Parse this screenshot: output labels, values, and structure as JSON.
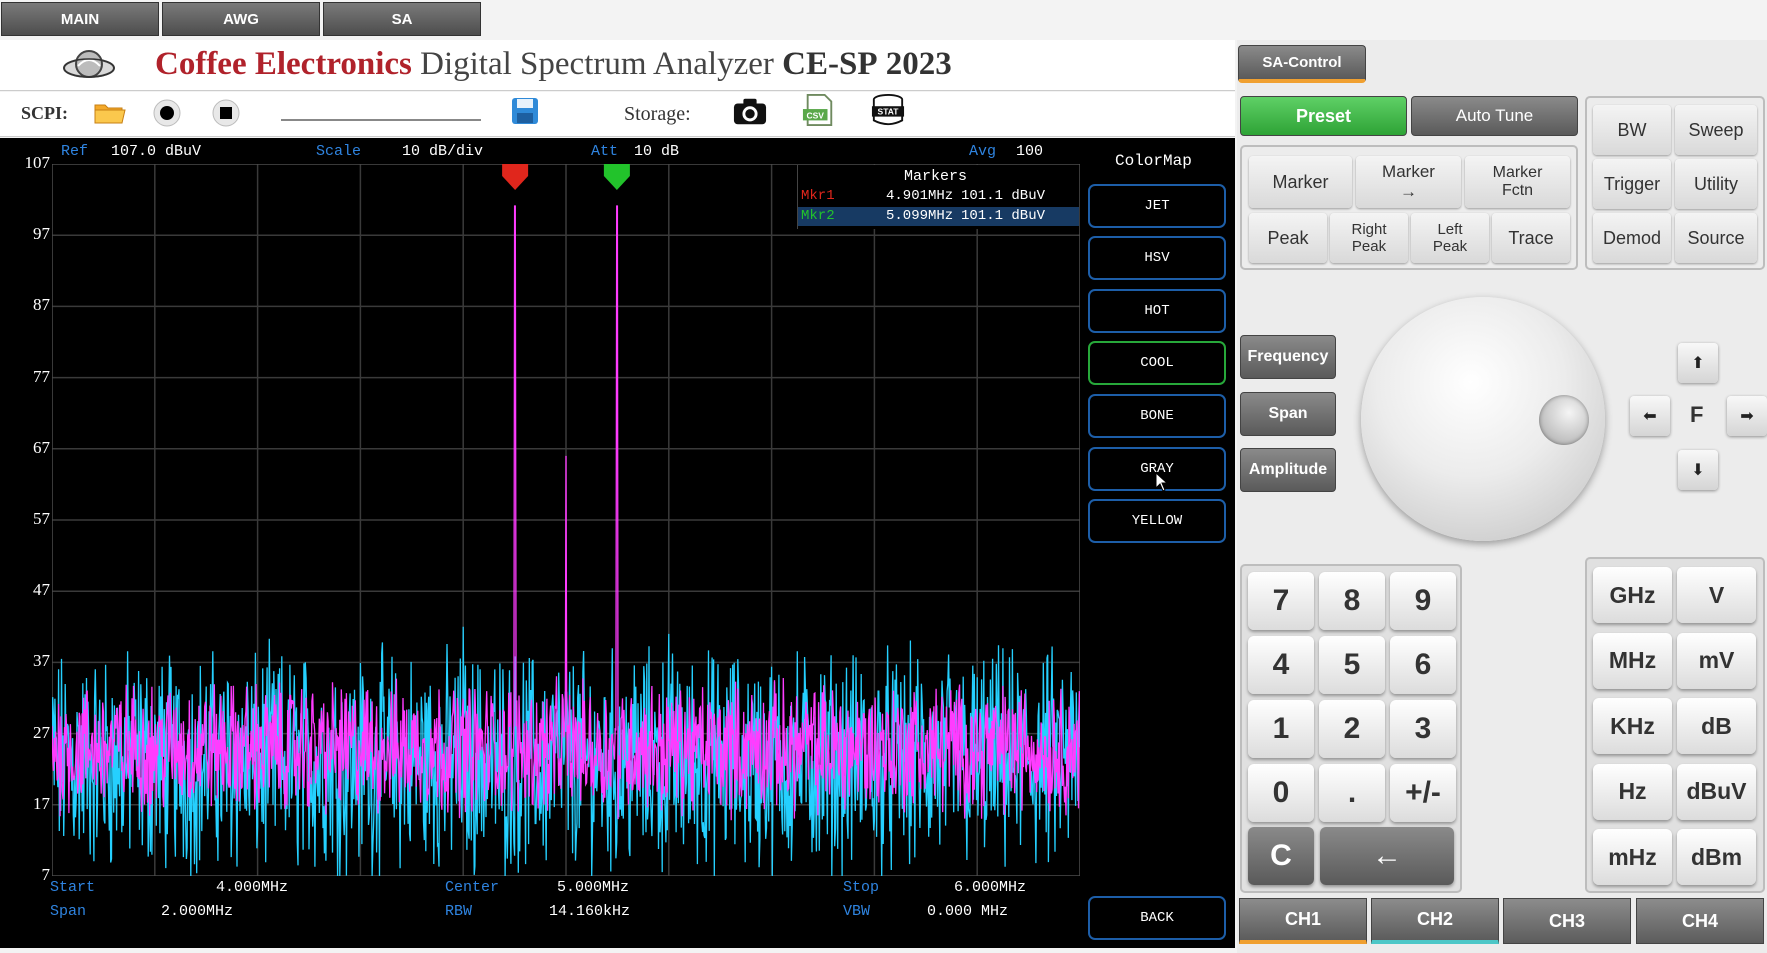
{
  "tabs": [
    "MAIN",
    "AWG",
    "SA"
  ],
  "header": {
    "brand": "Coffee Electronics",
    "subtitle": "Digital Spectrum Analyzer",
    "model": "CE-SP",
    "year": "2023"
  },
  "toolbar": {
    "scpi_label": "SCPI:",
    "storage_label": "Storage:",
    "icons": [
      "folder-icon",
      "record-icon",
      "stop-icon",
      "save-icon",
      "camera-icon",
      "csv-icon",
      "stat-icon"
    ],
    "csv_text": "CSV",
    "stat_text": "STAT"
  },
  "plot_header": {
    "ref_label": "Ref",
    "ref_value": "107.0 dBuV",
    "scale_label": "Scale",
    "scale_value": "10 dB/div",
    "att_label": "Att",
    "att_value": "10 dB",
    "avg_label": "Avg",
    "avg_value": "100"
  },
  "markers": {
    "title": "Markers",
    "rows": [
      {
        "name": "Mkr1",
        "freq": "4.901MHz",
        "level": "101.1 dBuV",
        "color": "#e0261c"
      },
      {
        "name": "Mkr2",
        "freq": "5.099MHz",
        "level": "101.1 dBuV",
        "color": "#22c32b"
      }
    ]
  },
  "plot_footer": {
    "start_label": "Start",
    "start_value": "4.000MHz",
    "center_label": "Center",
    "center_value": "5.000MHz",
    "stop_label": "Stop",
    "stop_value": "6.000MHz",
    "span_label": "Span",
    "span_value": "2.000MHz",
    "rbw_label": "RBW",
    "rbw_value": "14.160kHz",
    "vbw_label": "VBW",
    "vbw_value": "0.000 MHz"
  },
  "chart_data": {
    "type": "line",
    "xlabel": "",
    "ylabel": "",
    "xlim": [
      4.0,
      6.0
    ],
    "ylim": [
      7,
      107
    ],
    "y_ticks": [
      "107",
      "97",
      "87",
      "77",
      "67",
      "57",
      "47",
      "37",
      "27",
      "17",
      "7"
    ],
    "grid": true,
    "noise_floor": 25,
    "series": [
      {
        "color": "#ff3cff",
        "peaks": [
          {
            "x": 4.901,
            "y": 101.1
          },
          {
            "x": 5.099,
            "y": 101.1
          },
          {
            "x": 5.0,
            "y": 66
          }
        ]
      },
      {
        "color": "#25d0ff",
        "peaks": [
          {
            "x": 4.8,
            "y": 42
          },
          {
            "x": 5.2,
            "y": 41
          }
        ]
      }
    ],
    "markers": [
      {
        "x": 4.901,
        "y": 101.1,
        "color": "#e0261c"
      },
      {
        "x": 5.099,
        "y": 101.1,
        "color": "#22c32b"
      }
    ]
  },
  "colormap": {
    "title": "ColorMap",
    "options": [
      "JET",
      "HSV",
      "HOT",
      "COOL",
      "BONE",
      "GRAY",
      "YELLOW"
    ],
    "selected": "COOL",
    "back_label": "BACK"
  },
  "control": {
    "sa_control": "SA-Control",
    "preset": "Preset",
    "auto_tune": "Auto Tune",
    "marker": "Marker",
    "marker_arrow": "Marker\n→",
    "marker_fctn": "Marker\nFctn",
    "peak": "Peak",
    "right_peak": "Right\nPeak",
    "left_peak": "Left\nPeak",
    "trace": "Trace",
    "bw": "BW",
    "sweep": "Sweep",
    "trigger": "Trigger",
    "utility": "Utility",
    "demod": "Demod",
    "source": "Source",
    "frequency": "Frequency",
    "span": "Span",
    "amplitude": "Amplitude",
    "f_label": "F"
  },
  "keypad": {
    "keys": [
      "7",
      "8",
      "9",
      "4",
      "5",
      "6",
      "1",
      "2",
      "3",
      "0",
      ".",
      "+/-"
    ],
    "clear": "C",
    "backspace": "←"
  },
  "units": [
    "GHz",
    "V",
    "MHz",
    "mV",
    "KHz",
    "dB",
    "Hz",
    "dBuV",
    "mHz",
    "dBm"
  ],
  "channels": [
    "CH1",
    "CH2",
    "CH3",
    "CH4"
  ],
  "accent_colors": {
    "preset": "#34b33c",
    "orange_underline": "#f0a030",
    "teal_underline": "#4cc7c7"
  }
}
